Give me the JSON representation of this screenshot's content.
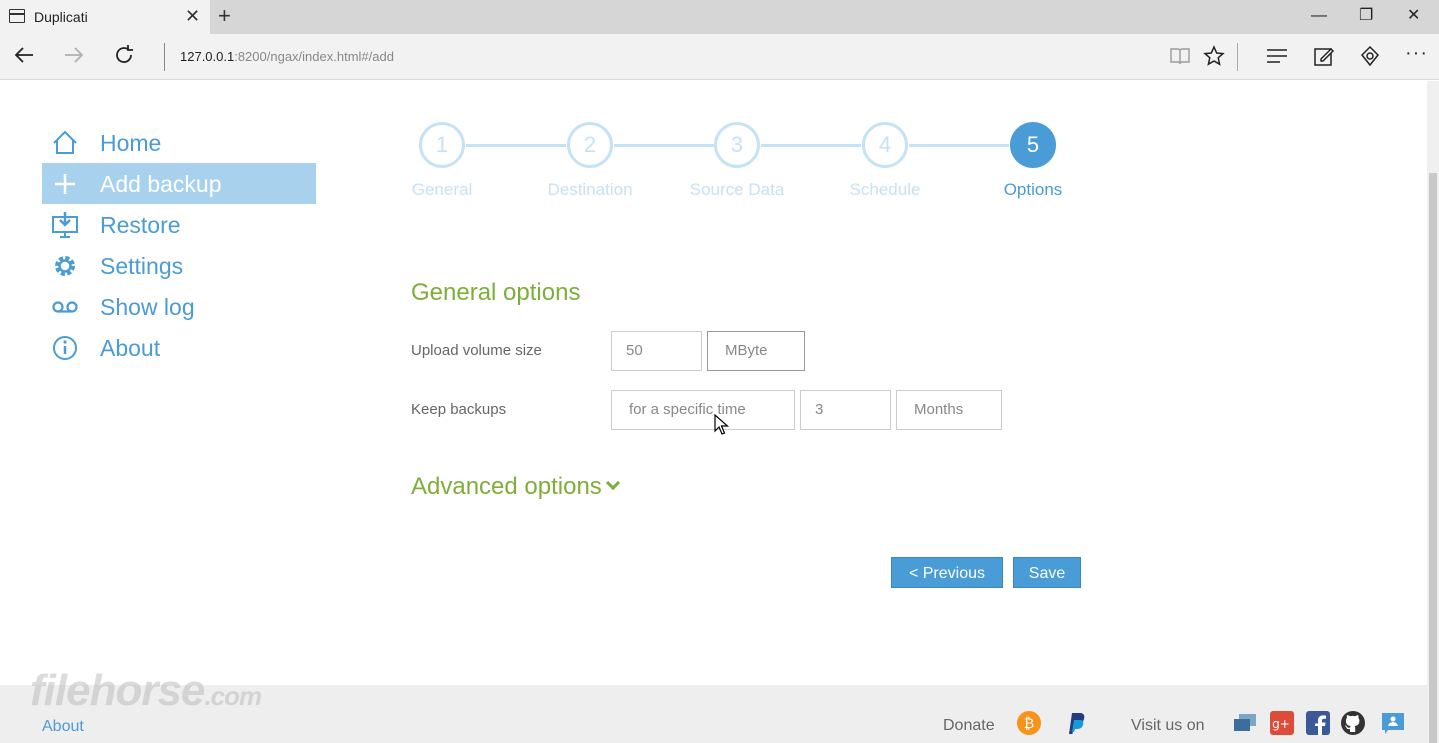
{
  "browser": {
    "tab_title": "Duplicati",
    "url_host": "127.0.0.1",
    "url_rest": ":8200/ngax/index.html#/add"
  },
  "sidebar": {
    "items": [
      {
        "label": "Home",
        "icon": "home-icon"
      },
      {
        "label": "Add backup",
        "icon": "plus-icon"
      },
      {
        "label": "Restore",
        "icon": "restore-icon"
      },
      {
        "label": "Settings",
        "icon": "gear-icon"
      },
      {
        "label": "Show log",
        "icon": "log-icon"
      },
      {
        "label": "About",
        "icon": "info-icon"
      }
    ],
    "active_index": 1
  },
  "steps": [
    {
      "number": "1",
      "label": "General"
    },
    {
      "number": "2",
      "label": "Destination"
    },
    {
      "number": "3",
      "label": "Source Data"
    },
    {
      "number": "4",
      "label": "Schedule"
    },
    {
      "number": "5",
      "label": "Options"
    }
  ],
  "active_step": 5,
  "general_options": {
    "title": "General options",
    "upload_volume_label": "Upload volume size",
    "upload_volume_value": "50",
    "upload_volume_unit": "MByte",
    "keep_backups_label": "Keep backups",
    "keep_mode": "for a specific time",
    "keep_value": "3",
    "keep_unit": "Months"
  },
  "advanced_options": "Advanced options",
  "buttons": {
    "previous": "< Previous",
    "save": "Save"
  },
  "footer": {
    "about": "About",
    "donate": "Donate",
    "visit": "Visit us on"
  },
  "watermark": {
    "main": "filehorse",
    "suffix": ".com"
  },
  "colors": {
    "accent": "#4a9cd6",
    "green": "#7eae3a",
    "active_bg": "#a8d1ee"
  }
}
